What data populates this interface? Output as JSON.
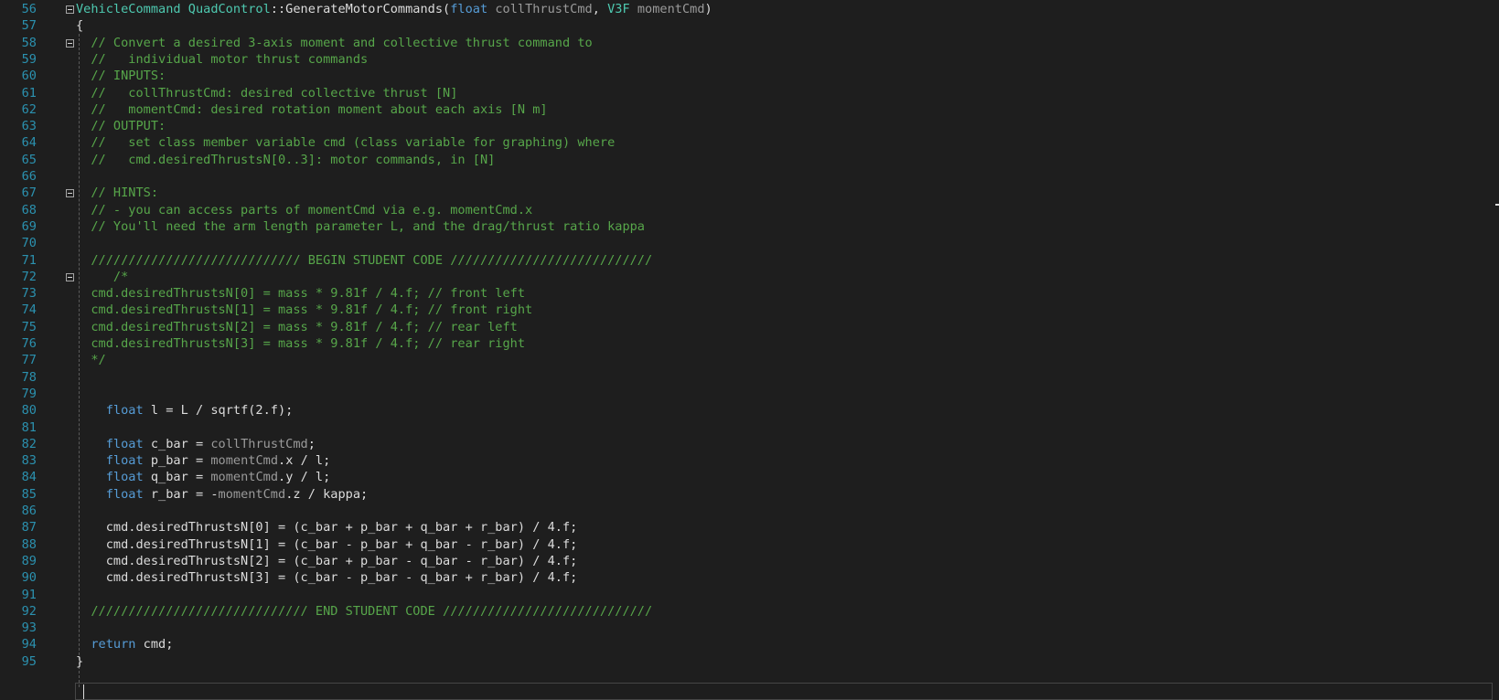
{
  "editor": {
    "lines": [
      {
        "n": "56",
        "text": "VehicleCommand QuadControl::GenerateMotorCommands(float collThrustCmd, V3F momentCmd)",
        "fold": true
      },
      {
        "n": "57",
        "text": "{",
        "fold": false
      },
      {
        "n": "58",
        "text": "  // Convert a desired 3-axis moment and collective thrust command to",
        "fold": true
      },
      {
        "n": "59",
        "text": "  //   individual motor thrust commands",
        "fold": false
      },
      {
        "n": "60",
        "text": "  // INPUTS:",
        "fold": false
      },
      {
        "n": "61",
        "text": "  //   collThrustCmd: desired collective thrust [N]",
        "fold": false
      },
      {
        "n": "62",
        "text": "  //   momentCmd: desired rotation moment about each axis [N m]",
        "fold": false
      },
      {
        "n": "63",
        "text": "  // OUTPUT:",
        "fold": false
      },
      {
        "n": "64",
        "text": "  //   set class member variable cmd (class variable for graphing) where",
        "fold": false
      },
      {
        "n": "65",
        "text": "  //   cmd.desiredThrustsN[0..3]: motor commands, in [N]",
        "fold": false
      },
      {
        "n": "66",
        "text": "",
        "fold": false
      },
      {
        "n": "67",
        "text": "  // HINTS:",
        "fold": true
      },
      {
        "n": "68",
        "text": "  // - you can access parts of momentCmd via e.g. momentCmd.x",
        "fold": false
      },
      {
        "n": "69",
        "text": "  // You'll need the arm length parameter L, and the drag/thrust ratio kappa",
        "fold": false
      },
      {
        "n": "70",
        "text": "",
        "fold": false
      },
      {
        "n": "71",
        "text": "  //////////////////////////// BEGIN STUDENT CODE ///////////////////////////",
        "fold": false
      },
      {
        "n": "72",
        "text": "     /*",
        "fold": true
      },
      {
        "n": "73",
        "text": "  cmd.desiredThrustsN[0] = mass * 9.81f / 4.f; // front left",
        "fold": false
      },
      {
        "n": "74",
        "text": "  cmd.desiredThrustsN[1] = mass * 9.81f / 4.f; // front right",
        "fold": false
      },
      {
        "n": "75",
        "text": "  cmd.desiredThrustsN[2] = mass * 9.81f / 4.f; // rear left",
        "fold": false
      },
      {
        "n": "76",
        "text": "  cmd.desiredThrustsN[3] = mass * 9.81f / 4.f; // rear right",
        "fold": false
      },
      {
        "n": "77",
        "text": "  */",
        "fold": false
      },
      {
        "n": "78",
        "text": "",
        "fold": false
      },
      {
        "n": "79",
        "text": "",
        "fold": false
      },
      {
        "n": "80",
        "text": "    float l = L / sqrtf(2.f);",
        "fold": false
      },
      {
        "n": "81",
        "text": "",
        "fold": false
      },
      {
        "n": "82",
        "text": "    float c_bar = collThrustCmd;",
        "fold": false
      },
      {
        "n": "83",
        "text": "    float p_bar = momentCmd.x / l;",
        "fold": false
      },
      {
        "n": "84",
        "text": "    float q_bar = momentCmd.y / l;",
        "fold": false
      },
      {
        "n": "85",
        "text": "    float r_bar = -momentCmd.z / kappa;",
        "fold": false
      },
      {
        "n": "86",
        "text": "",
        "fold": false
      },
      {
        "n": "87",
        "text": "    cmd.desiredThrustsN[0] = (c_bar + p_bar + q_bar + r_bar) / 4.f;",
        "fold": false
      },
      {
        "n": "88",
        "text": "    cmd.desiredThrustsN[1] = (c_bar - p_bar + q_bar - r_bar) / 4.f;",
        "fold": false
      },
      {
        "n": "89",
        "text": "    cmd.desiredThrustsN[2] = (c_bar + p_bar - q_bar - r_bar) / 4.f;",
        "fold": false
      },
      {
        "n": "90",
        "text": "    cmd.desiredThrustsN[3] = (c_bar - p_bar - q_bar + r_bar) / 4.f;",
        "fold": false
      },
      {
        "n": "91",
        "text": "",
        "fold": false
      },
      {
        "n": "92",
        "text": "  ///////////////////////////// END STUDENT CODE ////////////////////////////",
        "fold": false
      },
      {
        "n": "93",
        "text": "",
        "fold": false
      },
      {
        "n": "94",
        "text": "  return cmd;",
        "fold": false
      },
      {
        "n": "95",
        "text": "}",
        "fold": false
      }
    ]
  },
  "colors": {
    "background": "#1e1e1e",
    "line_number": "#2b91af",
    "keyword": "#569cd6",
    "type": "#4ec9b0",
    "comment": "#57a64a",
    "parameter": "#9a9a9a",
    "text": "#dcdcdc"
  }
}
